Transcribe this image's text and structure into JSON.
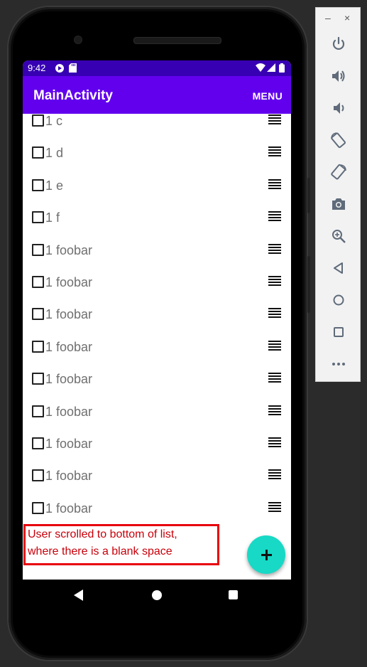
{
  "status_bar": {
    "time": "9:42"
  },
  "app_bar": {
    "title": "MainActivity",
    "menu_label": "MENU"
  },
  "list_items": [
    {
      "label": "1 c"
    },
    {
      "label": "1 d"
    },
    {
      "label": "1 e"
    },
    {
      "label": "1 f"
    },
    {
      "label": "1 foobar"
    },
    {
      "label": "1 foobar"
    },
    {
      "label": "1 foobar"
    },
    {
      "label": "1 foobar"
    },
    {
      "label": "1 foobar"
    },
    {
      "label": "1 foobar"
    },
    {
      "label": "1 foobar"
    },
    {
      "label": "1 foobar"
    },
    {
      "label": "1 foobar"
    }
  ],
  "annotation": {
    "line1": "User scrolled to bottom of list,",
    "line2": "where there is a blank space"
  },
  "fab": {
    "icon": "plus-icon",
    "color": "#17d9c5"
  },
  "colors": {
    "status_bar": "#3700b3",
    "app_bar": "#6200ee",
    "annotation": "#e8000d"
  },
  "emulator_toolbar": {
    "window_controls": {
      "minimize": "–",
      "close": "×"
    },
    "buttons": [
      "power-icon",
      "volume-up-icon",
      "volume-down-icon",
      "rotate-left-icon",
      "rotate-right-icon",
      "camera-icon",
      "zoom-icon",
      "back-icon",
      "home-icon",
      "overview-icon",
      "more-icon"
    ]
  }
}
